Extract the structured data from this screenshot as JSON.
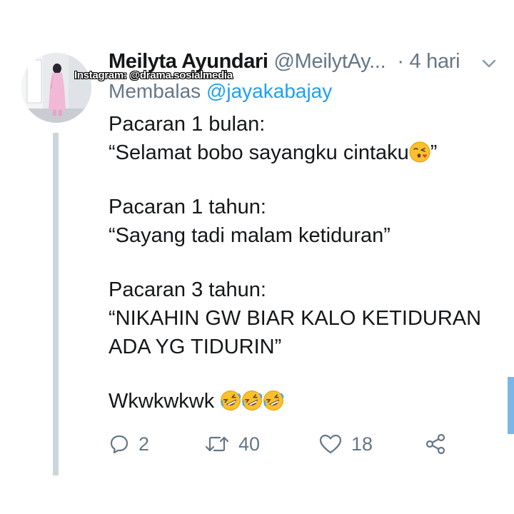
{
  "tweet": {
    "display_name": "Meilyta Ayundari",
    "handle": "@MeilytAy...",
    "time": "· 4 hari",
    "reply_prefix": "Membalas",
    "reply_to": "@jayakabajay",
    "lines": [
      "Pacaran 1 bulan:",
      "“Selamat bobo sayangku cintaku",
      "”",
      "Pacaran 1 tahun:",
      "“Sayang tadi malam ketiduran”",
      "Pacaran 3 tahun:",
      "“NIKAHIN GW BIAR KALO KETIDURAN",
      "ADA YG TIDURIN”",
      "Wkwkwkwk"
    ]
  },
  "watermark": "Instagram: @drama.sosialmedia",
  "actions": {
    "reply_count": "2",
    "retweet_count": "40",
    "like_count": "18"
  },
  "colors": {
    "text": "#14171a",
    "muted": "#657786",
    "link": "#1da1f2",
    "thread_line": "#cbd5dc",
    "scrollbar": "#7ab7e8"
  },
  "icons": {
    "kiss_emoji": "face-blowing-kiss-icon",
    "laugh_emoji": "rolling-on-floor-laughing-icon",
    "menu": "chevron-down-icon",
    "reply": "reply-bubble-icon",
    "retweet": "retweet-icon",
    "like": "heart-icon",
    "share": "share-icon"
  }
}
